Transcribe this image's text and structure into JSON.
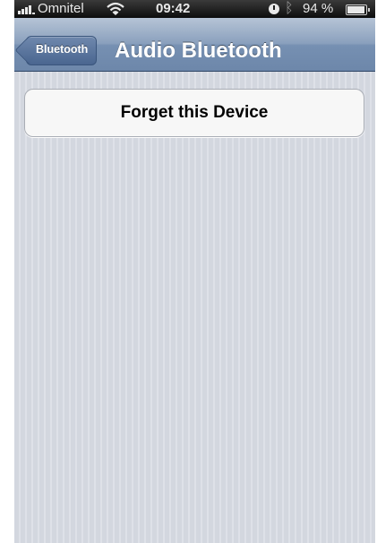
{
  "status_bar": {
    "carrier": "Omnitel",
    "time": "09:42",
    "battery_percent": "94 %",
    "battery_level": 0.94,
    "icons": [
      "signal-icon",
      "wifi-icon",
      "lock-rotation-icon",
      "bluetooth-icon",
      "battery-icon"
    ]
  },
  "nav": {
    "back_label": "Bluetooth",
    "title": "Audio Bluetooth"
  },
  "content": {
    "forget_button_label": "Forget this Device"
  },
  "colors": {
    "nav_bar": "#7690b2",
    "back_button": "#4a6690",
    "background": "#d6dae3",
    "button_background": "#f7f7f7"
  }
}
